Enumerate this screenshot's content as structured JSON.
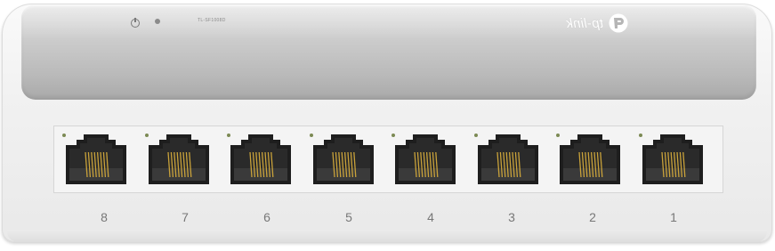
{
  "device": {
    "brand": "tp-link",
    "model_label": "TL-SF1008D"
  },
  "ports": [
    {
      "number": "8"
    },
    {
      "number": "7"
    },
    {
      "number": "6"
    },
    {
      "number": "5"
    },
    {
      "number": "4"
    },
    {
      "number": "3"
    },
    {
      "number": "2"
    },
    {
      "number": "1"
    }
  ],
  "colors": {
    "chassis": "#f1f1f1",
    "top_panel": "#c4c4c4",
    "port_interior": "#1e1e1e",
    "pins": "#c9a23a",
    "port_led": "#7c8a54"
  },
  "icons": [
    "power-icon",
    "tp-link-logo-mark"
  ]
}
